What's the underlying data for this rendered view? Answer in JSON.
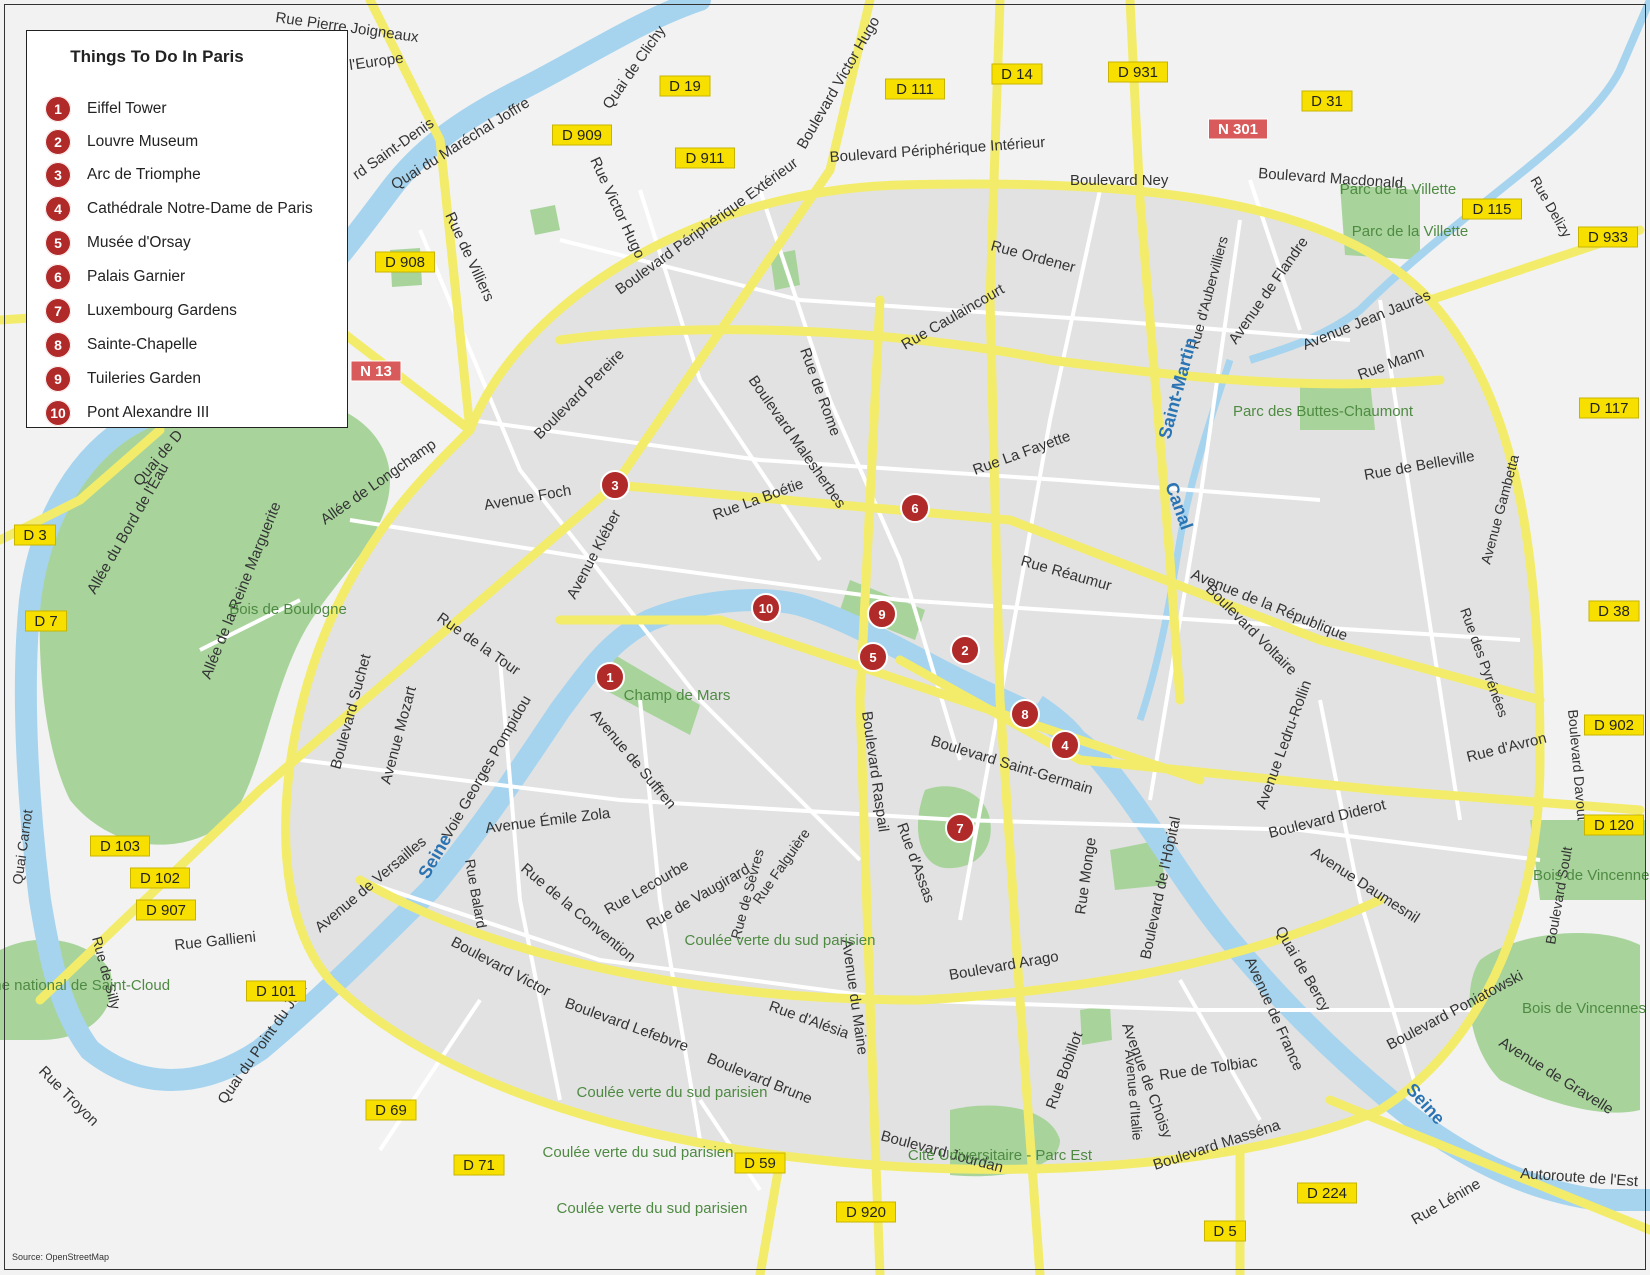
{
  "legend": {
    "title": "Things To Do In Paris",
    "items": [
      {
        "num": "1",
        "label": "Eiffel Tower"
      },
      {
        "num": "2",
        "label": "Louvre Museum"
      },
      {
        "num": "3",
        "label": "Arc de Triomphe"
      },
      {
        "num": "4",
        "label": "Cathédrale Notre-Dame de Paris"
      },
      {
        "num": "5",
        "label": "Musée d'Orsay"
      },
      {
        "num": "6",
        "label": "Palais Garnier"
      },
      {
        "num": "7",
        "label": "Luxembourg Gardens"
      },
      {
        "num": "8",
        "label": "Sainte-Chapelle"
      },
      {
        "num": "9",
        "label": "Tuileries Garden"
      },
      {
        "num": "10",
        "label": "Pont Alexandre III"
      }
    ]
  },
  "source": "Source: OpenStreetMap",
  "colors": {
    "marker": "#b12a2a",
    "road_major": "#f3ec6a",
    "water": "#a6d4ef",
    "park": "#a8d49c",
    "land": "#e5e5e5",
    "shield_yellow": "#f7e000",
    "shield_red": "#d95a5a"
  },
  "markers": [
    "1",
    "2",
    "3",
    "4",
    "5",
    "6",
    "7",
    "8",
    "9",
    "10"
  ],
  "shields": [
    "D 19",
    "D 111",
    "D 14",
    "D 931",
    "D 31",
    "D 909",
    "D 911",
    "N 301",
    "D 115",
    "D 933",
    "D 908",
    "N 13",
    "D 117",
    "D 3",
    "D 7",
    "D 38",
    "D 902",
    "D 120",
    "D 103",
    "D 102",
    "D 907",
    "D 101",
    "D 69",
    "D 71",
    "D 59",
    "D 920",
    "D 224",
    "D 5"
  ],
  "street_labels": [
    "Rue Pierre Joigneaux",
    "l'Europe",
    "Quai de Clichy",
    "Boulevard Victor Hugo",
    "Quai du Maréchal Joffre",
    "rd Saint-Denis",
    "Boulevard Périphérique Intérieur",
    "Boulevard Ney",
    "Boulevard Macdonald",
    "Rue Delizy",
    "Rue Victor Hugo",
    "Boulevard Périphérique Extérieur",
    "Rue de Villiers",
    "Rue Ordener",
    "Rue Caulaincourt",
    "Rue d'Aubervilliers",
    "Avenue de Flandre",
    "Avenue Jean Jaurès",
    "Rue Mann",
    "Boulevard Pereire",
    "Rue de Rome",
    "Boulevard Malesherbes",
    "Quai de D",
    "Allée de Longchamp",
    "Avenue Foch",
    "Rue La Boétie",
    "Rue La Fayette",
    "Rue de Belleville",
    "Avenue Gambetta",
    "Allée du Bord de l'Eau",
    "Allée de la Reine Marguerite",
    "Avenue Kléber",
    "Rue Réaumur",
    "Avenue de la République",
    "Boulevard Voltaire",
    "Rue de la Tour",
    "Boulevard Suchet",
    "Avenue Mozart",
    "Avenue de Suffren",
    "Rue des Pyrénées",
    "Avenue Ledru-Rollin",
    "Boulevard Raspail",
    "Boulevard Saint-Germain",
    "Rue d'Avron",
    "Boulevard Davout",
    "Quai Carnot",
    "Voie Georges Pompidou",
    "Avenue Émile Zola",
    "Rue d'Assas",
    "Rue Monge",
    "Boulevard Diderot",
    "Avenue Daumesnil",
    "Boulevard Soult",
    "Avenue de Versailles",
    "Rue Balard",
    "Rue de la Convention",
    "Rue Lecourbe",
    "Rue de Vaugirard",
    "Rue Falguière",
    "Boulevard de l'Hôpital",
    "Quai de Bercy",
    "Rue Gallieni",
    "Rue de Sèvres",
    "Boulevard Victor",
    "Avenue du Maine",
    "Boulevard Arago",
    "Avenue de France",
    "Boulevard Poniatowski",
    "Rue d'Alésia",
    "Boulevard Lefebvre",
    "Rue Bobillot",
    "Avenue de Choisy",
    "Avenue d'Italie",
    "Rue de Tolbiac",
    "Avenue de Gravelle",
    "Quai du Point du Jour",
    "Rue Troyon",
    "Boulevard Brune",
    "Boulevard Jourdan",
    "Boulevard Masséna",
    "Autoroute de l'Est",
    "Rue Lénine",
    "Rue de Silly"
  ],
  "area_labels": [
    "Parc de la Villette",
    "Parc de la Villette",
    "Parc des Buttes-Chaumont",
    "Bois de Boulogne",
    "Champ de Mars",
    "Bois de Vincennes",
    "Domaine national de Saint-Cloud",
    "Coulée verte du sud parisien",
    "Coulée verte du sud parisien",
    "Coulée verte du sud parisien",
    "Coulée verte du sud parisien",
    "Cité Universitaire - Parc Est",
    "Bois de Vincennes"
  ],
  "water_labels": [
    "Seine",
    "Seine",
    "Canal",
    "Saint-Martin"
  ]
}
